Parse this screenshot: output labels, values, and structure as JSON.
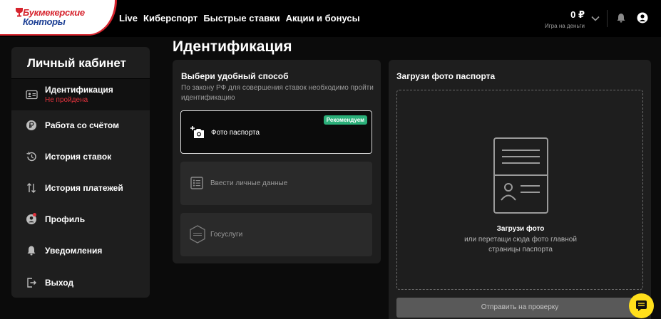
{
  "brand": {
    "line1": "Букмекерские",
    "line2": "Конторы"
  },
  "nav": {
    "items": [
      "Live",
      "Киберспорт",
      "Быстрые ставки",
      "Акции и бонусы"
    ]
  },
  "balance": {
    "amount": "0 ₽",
    "label": "Игра на деньги"
  },
  "sidebar": {
    "title": "Личный кабинет",
    "items": [
      {
        "label": "Идентификация",
        "status": "Не пройдена",
        "icon": "id-card-icon"
      },
      {
        "label": "Работа со счётом",
        "icon": "ruble-coin-icon"
      },
      {
        "label": "История ставок",
        "icon": "history-icon"
      },
      {
        "label": "История платежей",
        "icon": "transfer-arrows-icon"
      },
      {
        "label": "Профиль",
        "icon": "profile-icon"
      },
      {
        "label": "Уведомления",
        "icon": "bell-icon"
      },
      {
        "label": "Выход",
        "icon": "logout-icon"
      }
    ]
  },
  "page": {
    "title": "Идентификация"
  },
  "methods": {
    "title": "Выбери удобный способ",
    "description": "По закону РФ для совершения ставок необходимо пройти идентификацию",
    "options": [
      {
        "label": "Фото паспорта",
        "badge": "Рекомендуем",
        "icon": "add-photo-icon"
      },
      {
        "label": "Ввести личные данные",
        "icon": "form-list-icon"
      },
      {
        "label": "Госуслуги",
        "icon": "gosuslugi-icon"
      }
    ]
  },
  "upload": {
    "title": "Загрузи фото паспорта",
    "main": "Загрузи фото",
    "hint_line1": "или перетащи сюда фото главной",
    "hint_line2": "страницы паспорта",
    "submit_label": "Отправить на проверку"
  },
  "colors": {
    "accent_red": "#e0323c",
    "badge_green": "#2bb07a",
    "fab_yellow": "#ffdf1b"
  }
}
